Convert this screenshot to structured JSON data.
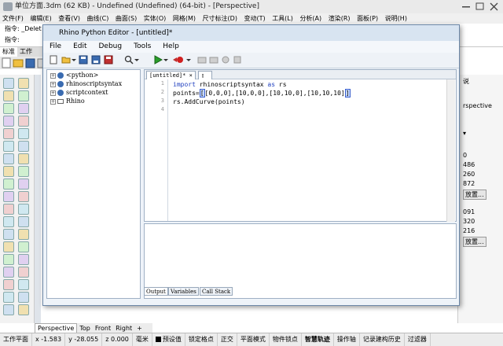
{
  "rhino": {
    "title": "单位方面.3dm (62 KB) - Undefined (Undefined) (64-bit) - [Perspective]",
    "menu": [
      "文件(F)",
      "编辑(E)",
      "查看(V)",
      "曲线(C)",
      "曲面(S)",
      "实体(O)",
      "网格(M)",
      "尺寸标注(D)",
      "变动(T)",
      "工具(L)",
      "分析(A)",
      "渲染(R)",
      "面板(P)",
      "说明(H)"
    ],
    "cmd_line1_label": "指令:",
    "cmd_line1_value": "_Delet",
    "cmd_line2_label": "指令:",
    "tabs": [
      "标准",
      "工作"
    ],
    "viewport_tabs": [
      "Perspective",
      "Top",
      "Front",
      "Right"
    ],
    "right_panel": {
      "tab": "说",
      "view_name": "rspective",
      "values": [
        "0",
        "486",
        "260",
        "872",
        "091",
        "320",
        "216"
      ],
      "button_label": "放置..."
    },
    "status": {
      "plane": "工作平面",
      "x": "x -1.583",
      "y": "y -28.055",
      "z": "z 0.000",
      "unit": "毫米",
      "layer": "预设值",
      "toggles": [
        "锁定格点",
        "正交",
        "平面模式",
        "物件锁点",
        "智慧轨迹",
        "操作轴",
        "记录建构历史",
        "过滤器"
      ]
    }
  },
  "editor": {
    "title": "Rhino Python Editor - [untitled]*",
    "menu": [
      "File",
      "Edit",
      "Debug",
      "Tools",
      "Help"
    ],
    "tree": [
      "<python>",
      "rhinoscriptsyntax",
      "scriptcontext",
      "Rhino"
    ],
    "doc_tab": "[untitled]*",
    "code": {
      "line1_kw1": "import",
      "line1_mod": " rhinoscriptsyntax ",
      "line1_kw2": "as",
      "line1_alias": " rs",
      "line2_pre": "points=",
      "line2_open": "[",
      "line2_body": "[0,0,0],[10,0,0],[10,10,0],[10,10,10]",
      "line2_close": "]",
      "line3": "rs.AddCurve(points)"
    },
    "output_tabs": [
      "Output",
      "Variables",
      "Call Stack"
    ]
  }
}
